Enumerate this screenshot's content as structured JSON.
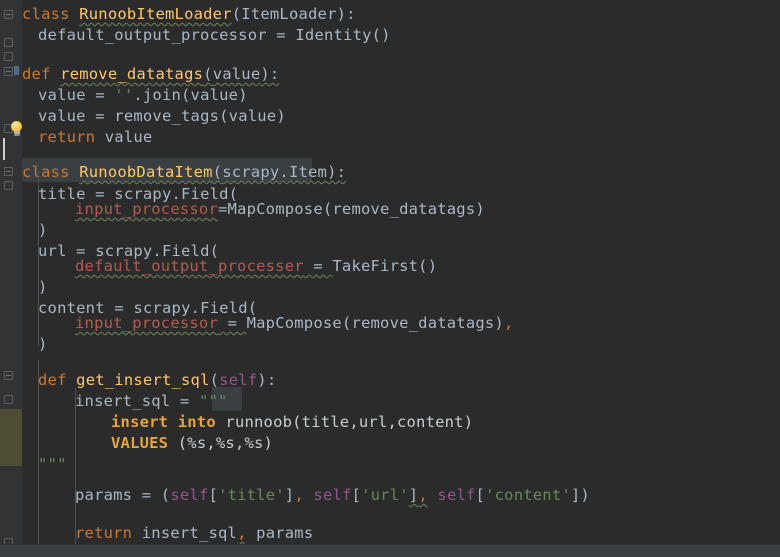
{
  "editor": {
    "language": "python",
    "theme": "darcula",
    "colors": {
      "background": "#2b2b2b",
      "gutter_background": "#313335",
      "default_text": "#a9b7c6",
      "keyword": "#cc7832",
      "function_name": "#ffc66d",
      "string": "#6a8759",
      "self_keyword": "#94558d",
      "warning_identifier": "#b25c4f",
      "sql_keyword": "#e8a33d",
      "sql_injection_background": "#4e4c33",
      "indent_guide": "#4b5052",
      "bottom_strip": "#3c3f41"
    },
    "caret": {
      "line_index": 7,
      "column": 0
    },
    "gutter_icons": [
      {
        "name": "intention-bulb-icon",
        "line_index": 6,
        "label": "Show intention actions"
      },
      {
        "name": "vcs-change-marker",
        "line_index": 3,
        "label": "Modified line marker"
      }
    ],
    "fold_markers": [
      {
        "name": "fold-marker-collapse",
        "line_index": 0
      },
      {
        "name": "fold-marker-collapse",
        "line_index": 1
      },
      {
        "name": "fold-marker-collapse",
        "line_index": 2
      },
      {
        "name": "fold-marker-collapse",
        "line_index": 3
      },
      {
        "name": "fold-marker-collapse",
        "line_index": 6
      },
      {
        "name": "fold-marker-collapse",
        "line_index": 8
      },
      {
        "name": "fold-marker-collapse",
        "line_index": 9
      },
      {
        "name": "fold-marker-collapse",
        "line_index": 16
      },
      {
        "name": "fold-marker-collapse",
        "line_index": 17
      },
      {
        "name": "fold-marker-collapse",
        "line_index": 19
      }
    ],
    "sql_injection_block": {
      "label": "SQL language injection highlight",
      "start_line_index": 18,
      "end_line_index": 19
    }
  },
  "code": {
    "lines": [
      {
        "index": 0,
        "text": "class RunoobItemLoader(ItemLoader):"
      },
      {
        "index": 1,
        "text": "    default_output_processor = Identity()"
      },
      {
        "index": 2,
        "text": ""
      },
      {
        "index": 3,
        "text": "def remove_datatags(value):"
      },
      {
        "index": 4,
        "text": "    value = ''.join(value)"
      },
      {
        "index": 5,
        "text": "    value = remove_tags(value)"
      },
      {
        "index": 6,
        "text": "    return value"
      },
      {
        "index": 7,
        "text": ""
      },
      {
        "index": 8,
        "text": "class RunoobDataItem(scrapy.Item):"
      },
      {
        "index": 9,
        "text": "    title = scrapy.Field("
      },
      {
        "index": 10,
        "text": "        input_processor=MapCompose(remove_datatags)"
      },
      {
        "index": 11,
        "text": "    )"
      },
      {
        "index": 12,
        "text": "    url = scrapy.Field("
      },
      {
        "index": 13,
        "text": "        default_output_processer = TakeFirst()"
      },
      {
        "index": 14,
        "text": "    )"
      },
      {
        "index": 15,
        "text": "    content = scrapy.Field("
      },
      {
        "index": 16,
        "text": "        input_processor = MapCompose(remove_datatags),"
      },
      {
        "index": 17,
        "text": "    )"
      },
      {
        "index": 18,
        "text": ""
      },
      {
        "index": 19,
        "text": "    def get_insert_sql(self):"
      },
      {
        "index": 20,
        "text": "        insert_sql = \"\"\""
      },
      {
        "index": 21,
        "text": "            insert into runnoob(title,url,content)"
      },
      {
        "index": 22,
        "text": "            VALUES (%s,%s,%s)"
      },
      {
        "index": 23,
        "text": "        \"\"\""
      },
      {
        "index": 24,
        "text": ""
      },
      {
        "index": 25,
        "text": "        params = (self['title'], self['url'], self['content'])"
      },
      {
        "index": 26,
        "text": ""
      },
      {
        "index": 27,
        "text": "        return insert_sql, params"
      }
    ],
    "identifiers": {
      "class_keyword": "class",
      "def_keyword": "def",
      "return_keyword": "return",
      "self_keyword": "self",
      "class_name_1": "RunoobItemLoader",
      "base_class_1": "ItemLoader",
      "attr_default_output_processor": "default_output_processor",
      "identity_call": "Identity()",
      "function_remove_datatags": "remove_datatags",
      "param_value": "value",
      "join_expr": "''.join(value)",
      "remove_tags_call": "remove_tags(value)",
      "class_name_2": "RunoobDataItem",
      "base_class_2": "scrapy.Item",
      "field_title": "title",
      "field_url": "url",
      "field_content": "content",
      "scrapy_field": "scrapy.Field(",
      "input_processor": "input_processor",
      "map_compose": "MapCompose",
      "default_output_processer": "default_output_processer",
      "take_first": "TakeFirst()",
      "method_get_insert_sql": "get_insert_sql",
      "var_insert_sql": "insert_sql",
      "var_params": "params",
      "triple_quote": "\"\"\"",
      "sql_insert_into": "insert into",
      "sql_table": "runnoob(title,url,content)",
      "sql_values_keyword": "VALUES",
      "sql_placeholders": "(%s,%s,%s)",
      "params_tuple": "(self['title'], self['url'], self['content'])",
      "return_stmt": "return insert_sql, params"
    }
  }
}
